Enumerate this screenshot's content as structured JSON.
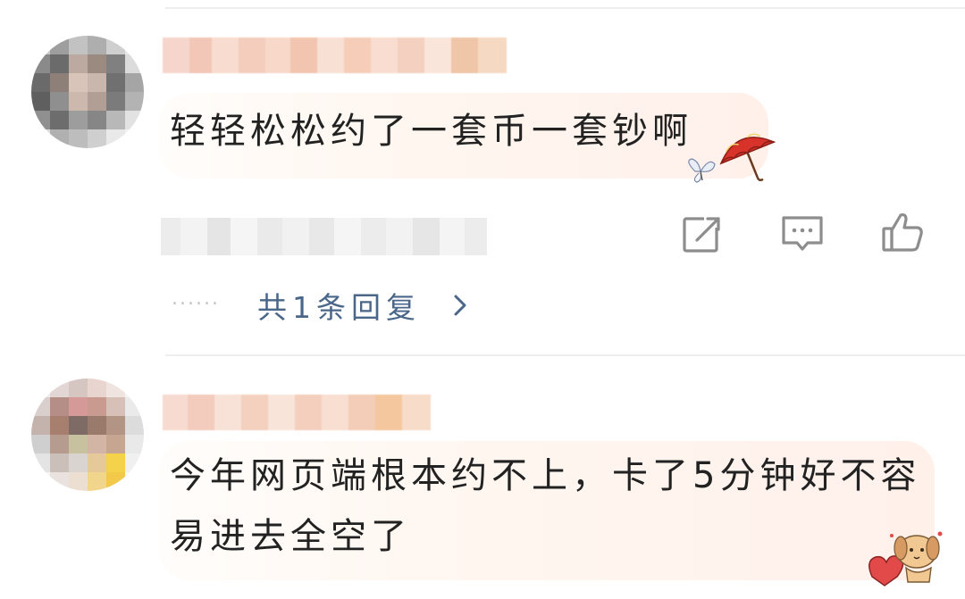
{
  "comments": [
    {
      "text": "轻轻松松约了一套币一套钞啊",
      "actions": {
        "share_icon": "share-icon",
        "reply_icon": "comment-icon",
        "like_icon": "thumbs-up-icon"
      },
      "replies": {
        "label": "共1条回复",
        "dots": "......",
        "chevron": "›"
      },
      "sticker": "umbrella-butterfly-sticker"
    },
    {
      "text_line1": "今年网页端根本约不上，卡了5分钟好不容",
      "text_line2": "易进去全空了",
      "sticker": "puppy-heart-sticker"
    }
  ],
  "colors": {
    "reply_link": "#4a6789",
    "icon_gray": "#8d8d8d",
    "bubble_tint": "#fff0ea"
  }
}
